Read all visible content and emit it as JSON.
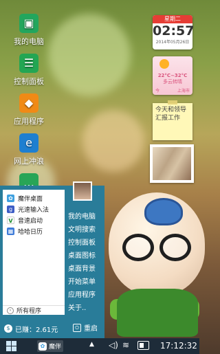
{
  "desktop_icons": [
    {
      "label": "我的电脑",
      "icon": "computer-icon"
    },
    {
      "label": "控制面板",
      "icon": "control-panel-icon"
    },
    {
      "label": "应用程序",
      "icon": "dropbox-apps-icon"
    },
    {
      "label": "网上冲浪",
      "icon": "internet-explorer-icon"
    }
  ],
  "widgets": {
    "clock": {
      "weekday": "星期二",
      "time": "02:57",
      "date": "2014年05月26日"
    },
    "weather": {
      "temperature": "22°C~32°C",
      "condition": "多云转晴",
      "left_label": "今",
      "right_label": "上海市"
    },
    "note": {
      "text": "今天和领导汇报工作"
    }
  },
  "start_menu": {
    "left_items": [
      {
        "label": "魔伴桌面",
        "icon": "magic-desktop-icon"
      },
      {
        "label": "光速输入法",
        "icon": "input-method-icon"
      },
      {
        "label": "音速启动",
        "icon": "vfast-launcher-icon"
      },
      {
        "label": "哈哈日历",
        "icon": "calendar-icon"
      }
    ],
    "all_programs": "所有程序",
    "right_items": [
      "我的电脑",
      "文明搜索",
      "控制面板",
      "桌面图标",
      "桌面背景",
      "开始菜单",
      "应用程序",
      "关于.."
    ],
    "earned": "已赚：2.61元",
    "restart": "重启"
  },
  "taskbar": {
    "active_app": "魔伴",
    "time": "17:12:32"
  },
  "colors": {
    "menu_bg": "#297c99",
    "taskbar_bg": "#1e2c39"
  }
}
